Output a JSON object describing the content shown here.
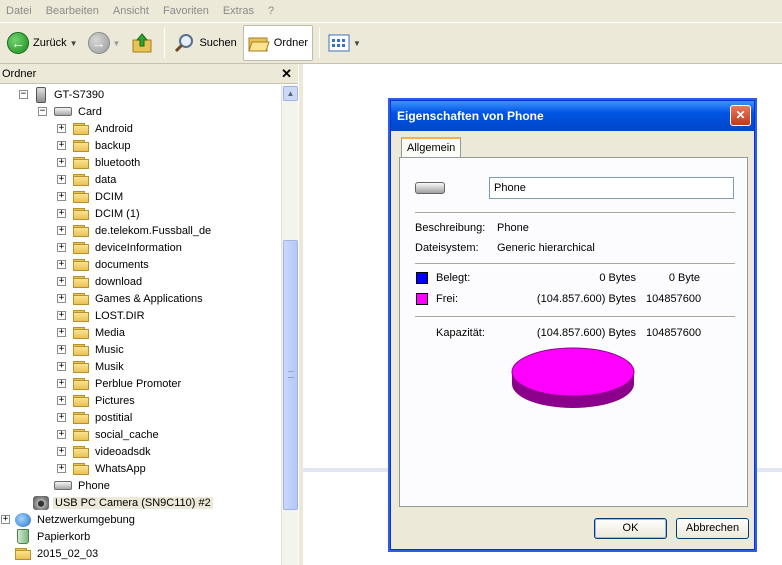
{
  "menu": [
    "Datei",
    "Bearbeiten",
    "Ansicht",
    "Favoriten",
    "Extras",
    "?"
  ],
  "toolbar": {
    "back_label": "Zurück",
    "search_label": "Suchen",
    "folders_label": "Ordner"
  },
  "tree": {
    "header": "Ordner",
    "device": "GT-S7390",
    "card": "Card",
    "folders": [
      "Android",
      "backup",
      "bluetooth",
      "data",
      "DCIM",
      "DCIM (1)",
      "de.telekom.Fussball_de",
      "deviceInformation",
      "documents",
      "download",
      "Games & Applications",
      "LOST.DIR",
      "Media",
      "Music",
      "Musik",
      "Perblue Promoter",
      "Pictures",
      "postitial",
      "social_cache",
      "videoadsdk",
      "WhatsApp"
    ],
    "phone": "Phone",
    "camera": "USB PC Camera (SN9C110) #2",
    "network": "Netzwerkumgebung",
    "recycle": "Papierkorb",
    "dated_folder": "2015_02_03"
  },
  "dialog": {
    "title": "Eigenschaften von Phone",
    "tab": "Allgemein",
    "name_value": "Phone",
    "description_label": "Beschreibung:",
    "description_value": "Phone",
    "filesystem_label": "Dateisystem:",
    "filesystem_value": "Generic hierarchical",
    "used_label": "Belegt:",
    "used_bytes": "0 Bytes",
    "used_short": "0 Byte",
    "free_label": "Frei:",
    "free_bytes": "(104.857.600) Bytes",
    "free_short": "104857600",
    "capacity_label": "Kapazität:",
    "capacity_bytes": "(104.857.600) Bytes",
    "capacity_short": "104857600",
    "ok_label": "OK",
    "cancel_label": "Abbrechen",
    "colors": {
      "used": "#0000ff",
      "free": "#ff00ff",
      "pie_side": "#8b008b"
    }
  }
}
